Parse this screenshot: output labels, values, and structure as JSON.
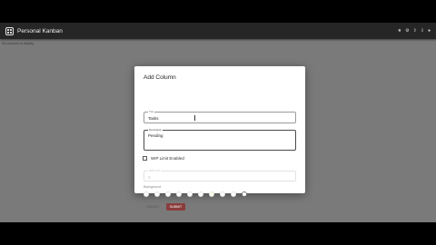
{
  "app": {
    "title": "Personal Kanban",
    "board_message": "No columns to display"
  },
  "appbar_icons": [
    "star-icon",
    "settings-icon",
    "export-icon",
    "import-icon",
    "github-icon"
  ],
  "dialog": {
    "title": "Add Column",
    "title_field": {
      "label": "Title",
      "value": "Tasks"
    },
    "description_field": {
      "label": "Description",
      "value": "Pending"
    },
    "wip_checkbox": {
      "label": "WIP Limit Enabled",
      "checked": false
    },
    "wip_limit_field": {
      "label": "WIP Limit",
      "value": "0",
      "disabled": true
    },
    "background": {
      "label": "Background",
      "swatches": [
        "#ffffff",
        "#ffffff",
        "#ffffff",
        "#ffffff",
        "#ffffff",
        "#ffffff",
        "#fffde7",
        "#ffffff",
        "#ffffff",
        "#ffffff"
      ],
      "selected_index": 9
    },
    "cancel_label": "CANCEL",
    "submit_label": "SUBMIT"
  },
  "colors": {
    "appbar": "#262626",
    "backdrop": "#7a7a7a",
    "submit": "#8a3c3c"
  }
}
